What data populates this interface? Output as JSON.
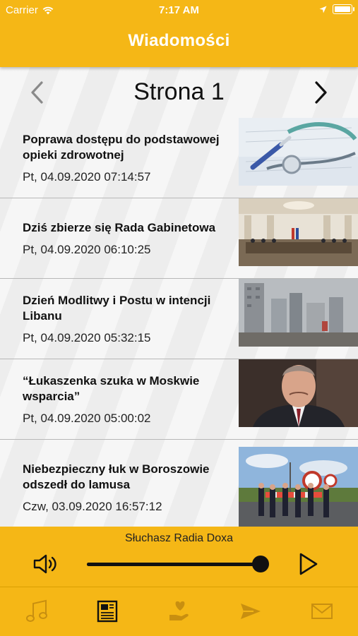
{
  "status_bar": {
    "carrier": "Carrier",
    "time": "7:17 AM",
    "icons": [
      "wifi-icon",
      "location-arrow-icon",
      "battery-icon"
    ]
  },
  "header": {
    "title": "Wiadomości"
  },
  "pager": {
    "title": "Strona 1",
    "prev_icon": "chevron-left-icon",
    "next_icon": "chevron-right-icon"
  },
  "news": [
    {
      "title": "Poprawa dostępu do podstawowej opieki zdrowotnej",
      "date": "Pt, 04.09.2020 07:14:57",
      "image": "stethoscope-photo"
    },
    {
      "title": "Dziś zbierze się Rada Gabinetowa",
      "date": "Pt, 04.09.2020 06:10:25",
      "image": "cabinet-meeting-photo"
    },
    {
      "title": "Dzień Modlitwy i Postu w intencji Libanu",
      "date": "Pt, 04.09.2020 05:32:15",
      "image": "beirut-ruins-photo"
    },
    {
      "title": "“Łukaszenka szuka w Moskwie wsparcia”",
      "date": "Pt, 04.09.2020 05:00:02",
      "image": "lukashenko-portrait-photo"
    },
    {
      "title": "Niebezpieczny łuk w Boroszowie odszedł do lamusa",
      "date": "Czw, 03.09.2020 16:57:12",
      "image": "road-opening-photo"
    }
  ],
  "player": {
    "label": "Słuchasz Radia Doxa",
    "volume_level": 1.0,
    "volume_icon": "speaker-icon",
    "play_icon": "play-icon"
  },
  "tabs": [
    {
      "icon": "music-note-icon",
      "active": false
    },
    {
      "icon": "newspaper-icon",
      "active": true
    },
    {
      "icon": "donate-hand-heart-icon",
      "active": false
    },
    {
      "icon": "send-paper-plane-icon",
      "active": false
    },
    {
      "icon": "envelope-icon",
      "active": false
    }
  ],
  "colors": {
    "accent": "#f5b716",
    "text": "#111111",
    "inactive_icon": "#c88f10"
  }
}
